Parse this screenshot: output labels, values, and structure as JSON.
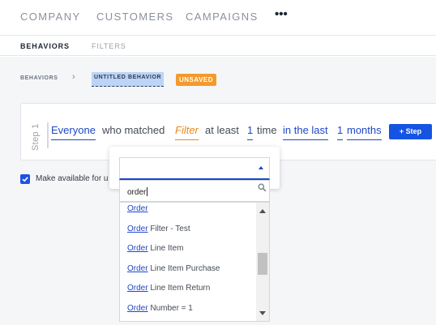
{
  "topnav": {
    "items": [
      "COMPANY",
      "CUSTOMERS",
      "CAMPAIGNS"
    ],
    "more_label": "•••"
  },
  "subnav": {
    "items": [
      "BEHAVIORS",
      "FILTERS"
    ],
    "active": "BEHAVIORS"
  },
  "breadcrumb": {
    "root": "BEHAVIORS",
    "separator": "›",
    "current": "UNTITLED BEHAVIOR",
    "badge": "UNSAVED"
  },
  "step": {
    "label": "Step 1",
    "tokens": {
      "subject": "Everyone",
      "who_matched": "who matched",
      "filter": "Filter",
      "at_least": "at least",
      "count": "1",
      "time": "time",
      "in_the_last": "in the last",
      "period_count": "1",
      "period_unit": "months"
    },
    "add_button": "+ Step"
  },
  "checkbox": {
    "checked": true,
    "label": "Make available for u"
  },
  "dropdown": {
    "selected_value": "",
    "search_value": "order",
    "options": [
      {
        "match": "Order",
        "rest": ""
      },
      {
        "match": "Order",
        "rest": " Filter - Test"
      },
      {
        "match": "Order",
        "rest": " Line Item"
      },
      {
        "match": "Order",
        "rest": " Line Item Purchase"
      },
      {
        "match": "Order",
        "rest": " Line Item Return"
      },
      {
        "match": "Order",
        "rest": " Number = 1"
      }
    ]
  },
  "colors": {
    "accent": "#1d47c7",
    "button": "#1554e2",
    "filter": "#e58a1f",
    "badge": "#f39a2b",
    "selection": "#bcd4f5"
  }
}
